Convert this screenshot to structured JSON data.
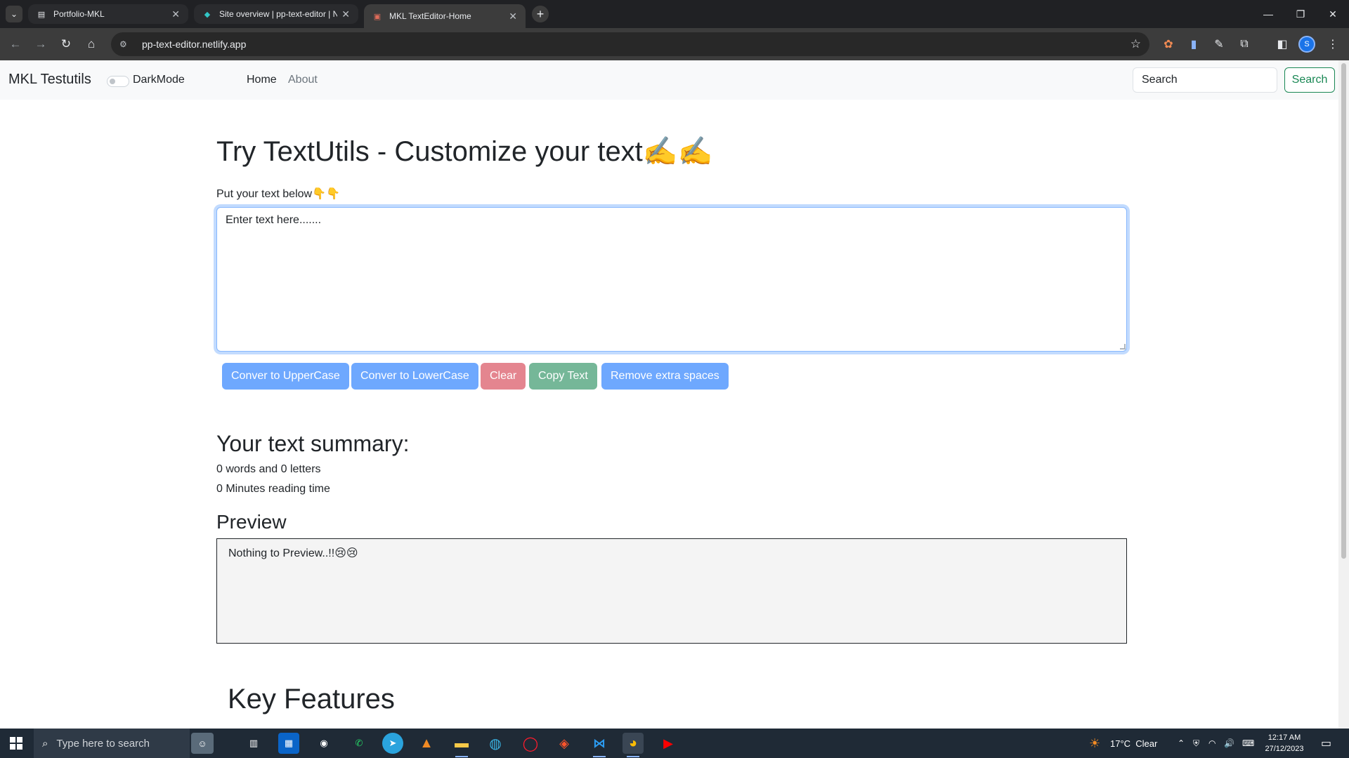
{
  "browser": {
    "tabs": [
      {
        "title": "Portfolio-MKL",
        "active": false
      },
      {
        "title": "Site overview | pp-text-editor | N",
        "active": false
      },
      {
        "title": "MKL TextEditor-Home",
        "active": true
      }
    ],
    "url": "pp-text-editor.netlify.app",
    "profile_initial": "S",
    "icons": {
      "tab_list": "chevron-down-icon",
      "new_tab": "plus-icon",
      "back": "arrow-left-icon",
      "forward": "arrow-right-icon",
      "reload": "reload-icon",
      "home": "home-icon",
      "bookmark": "star-icon"
    }
  },
  "navbar": {
    "brand": "MKL Testutils",
    "dark_mode_label": "DarkMode",
    "dark_mode_on": false,
    "links": [
      "Home",
      "About"
    ],
    "search_placeholder": "Search",
    "search_button": "Search"
  },
  "main": {
    "heading": "Try TextUtils - Customize your text",
    "heading_emoji": "✍️✍️",
    "input_label": "Put your text below",
    "input_label_emoji": "👇👇",
    "textarea_placeholder": "Enter text here.......",
    "buttons": [
      {
        "label": "Conver to UpperCase",
        "style": "primary"
      },
      {
        "label": "Conver to LowerCase",
        "style": "primary"
      },
      {
        "label": "Clear",
        "style": "danger"
      },
      {
        "label": "Copy Text",
        "style": "success"
      },
      {
        "label": "Remove extra spaces",
        "style": "primary"
      }
    ],
    "summary_heading": "Your text summary:",
    "summary_words_line": "0 words and 0 letters",
    "summary_time_line": "0 Minutes reading time",
    "preview_heading": "Preview",
    "preview_text": "Nothing to Preview..!!😢😢",
    "features_heading": "Key Features"
  },
  "taskbar": {
    "search_placeholder": "Type here to search",
    "weather_temp": "17°C",
    "weather_text": "Clear",
    "time": "12:17 AM",
    "date": "27/12/2023"
  },
  "colors": {
    "primary_button": "#6ea8fe",
    "danger_button": "#e4858f",
    "success_button": "#75b798",
    "search_outline": "#198754",
    "navbar_bg": "#f8f9fa"
  }
}
